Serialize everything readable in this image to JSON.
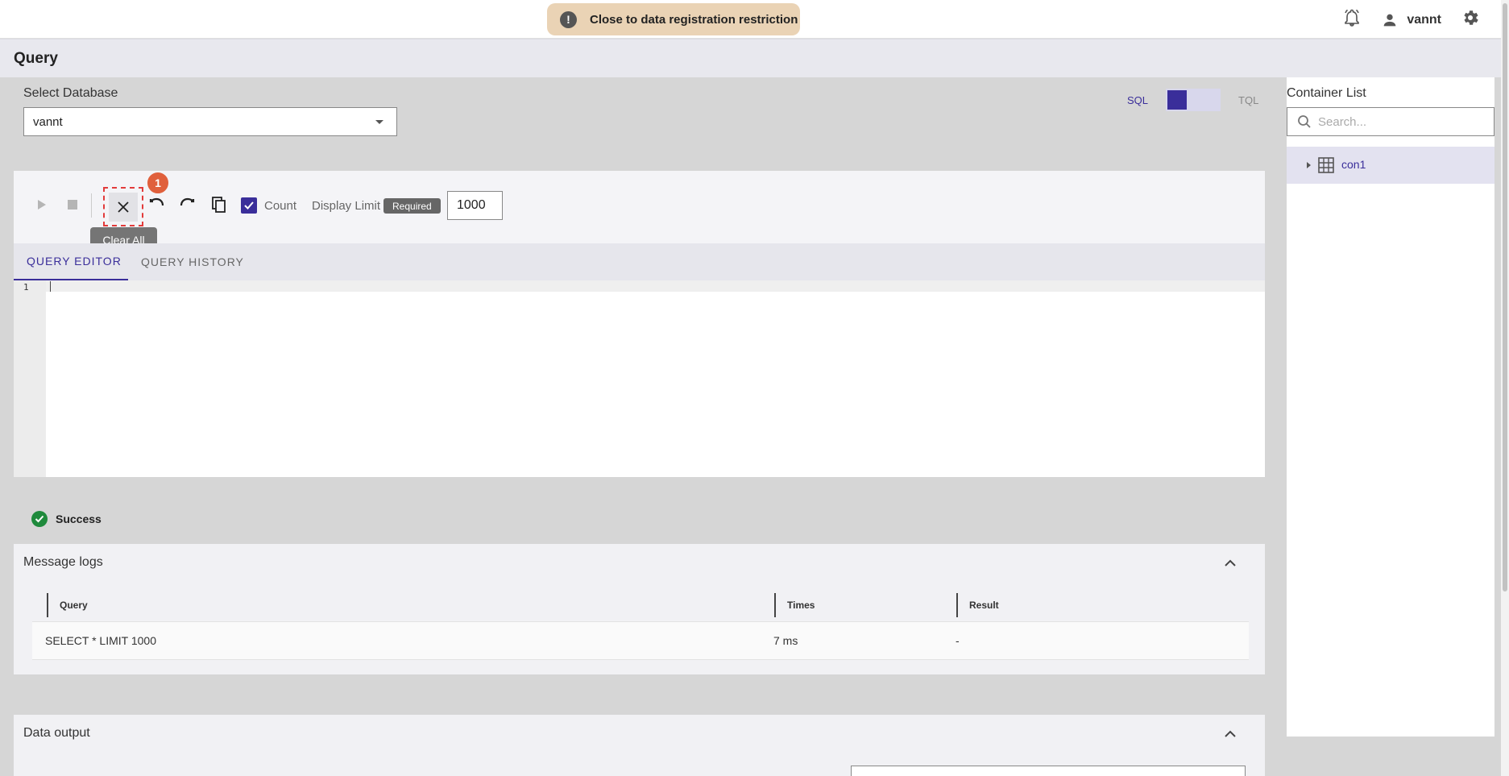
{
  "topbar": {
    "warning_text": "Close to data registration restriction",
    "username": "vannt"
  },
  "page": {
    "title": "Query"
  },
  "database": {
    "label": "Select Database",
    "selected": "vannt"
  },
  "mode": {
    "sql_label": "SQL",
    "tql_label": "TQL"
  },
  "toolbar": {
    "badge": "1",
    "tooltip": "Clear All",
    "count_label": "Count",
    "count_checked": true,
    "display_limit_label": "Display Limit",
    "required_label": "Required",
    "display_limit_value": "1000"
  },
  "tabs": {
    "editor": "QUERY EDITOR",
    "history": "QUERY HISTORY"
  },
  "editor": {
    "line_number": "1"
  },
  "status": {
    "text": "Success"
  },
  "message_logs": {
    "title": "Message logs",
    "columns": {
      "query": "Query",
      "times": "Times",
      "result": "Result"
    },
    "rows": [
      {
        "query": "SELECT * LIMIT 1000",
        "times": "7 ms",
        "result": "-"
      }
    ]
  },
  "data_output": {
    "title": "Data output"
  },
  "container_list": {
    "title": "Container List",
    "search_placeholder": "Search...",
    "items": [
      {
        "label": "con1"
      }
    ]
  },
  "colors": {
    "accent": "#3a2e9a",
    "warning_bg": "#ead3b5",
    "success": "#1f8a3c",
    "highlight": "#e23b3b"
  }
}
